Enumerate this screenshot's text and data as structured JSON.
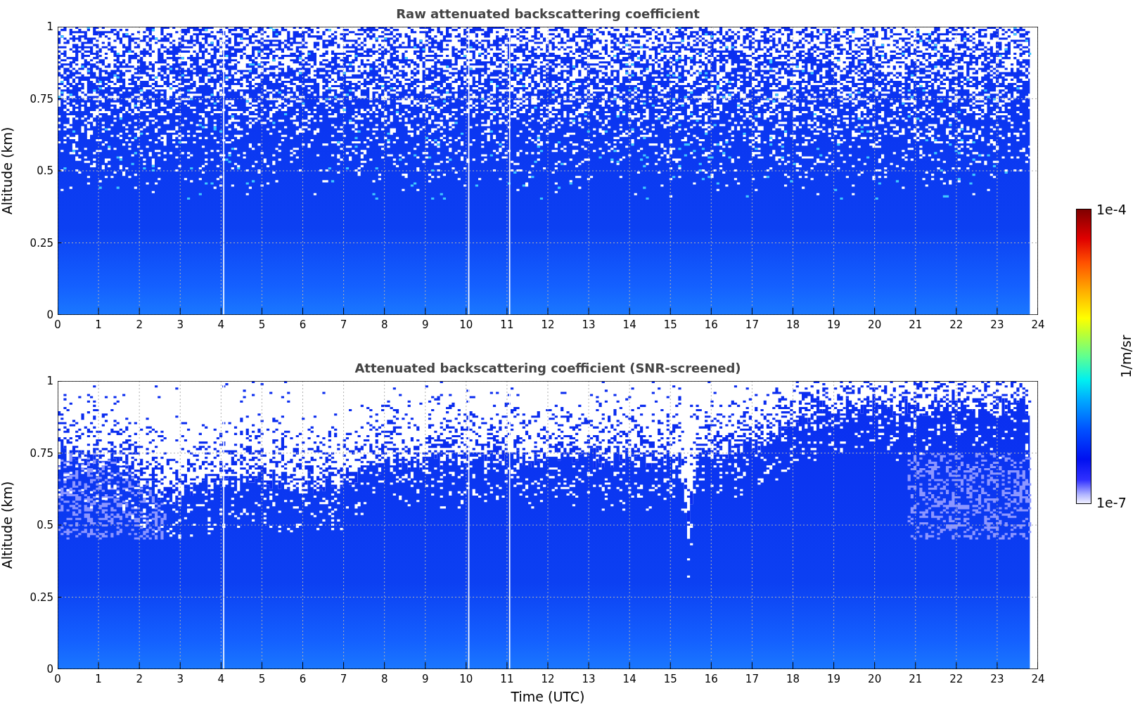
{
  "panels": [
    {
      "kind": "raw",
      "title": "Raw attenuated backscattering coefficient",
      "ylabel": "Altitude (km)",
      "yticks": [
        "1",
        "0.75",
        "0.5",
        "0.25",
        "0"
      ],
      "xticks": [
        "0",
        "1",
        "2",
        "3",
        "4",
        "5",
        "6",
        "7",
        "8",
        "9",
        "10",
        "11",
        "12",
        "13",
        "14",
        "15",
        "16",
        "17",
        "18",
        "19",
        "20",
        "21",
        "22",
        "23",
        "24"
      ]
    },
    {
      "kind": "screened",
      "title": "Attenuated backscattering coefficient (SNR-screened)",
      "ylabel": "Altitude (km)",
      "yticks": [
        "1",
        "0.75",
        "0.5",
        "0.25",
        "0"
      ],
      "xticks": [
        "0",
        "1",
        "2",
        "3",
        "4",
        "5",
        "6",
        "7",
        "8",
        "9",
        "10",
        "11",
        "12",
        "13",
        "14",
        "15",
        "16",
        "17",
        "18",
        "19",
        "20",
        "21",
        "22",
        "23",
        "24"
      ]
    }
  ],
  "xlabel": "Time (UTC)",
  "colorbar": {
    "max_label": "1e-4",
    "min_label": "1e-7",
    "label": "1/m/sr"
  }
}
